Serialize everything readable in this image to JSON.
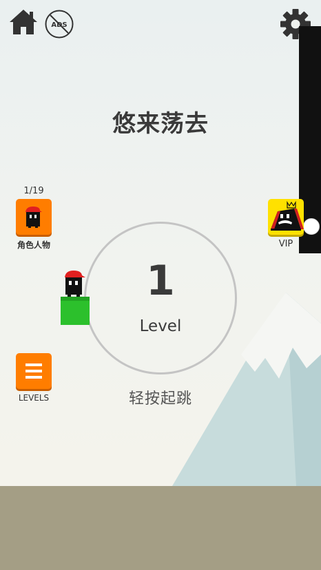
{
  "title": "悠来荡去",
  "top_bar": {
    "home_icon": "home-icon",
    "ads_label": "ADS",
    "ads_icon": "no-ads-icon",
    "settings_icon": "gear-icon"
  },
  "character": {
    "count": "1/19",
    "label": "角色人物",
    "icon": "character-icon"
  },
  "levels": {
    "label": "LEVELS",
    "icon": "menu-list-icon"
  },
  "vip": {
    "label": "VIP",
    "icon": "crowned-character-icon"
  },
  "level": {
    "number": "1",
    "word": "Level"
  },
  "hint": "轻按起跳",
  "colors": {
    "orange_button": "#ff7d00",
    "vip_button": "#ffe100",
    "block": "#2cc02c",
    "ground": "#a49e85",
    "cap": "#e02020"
  }
}
